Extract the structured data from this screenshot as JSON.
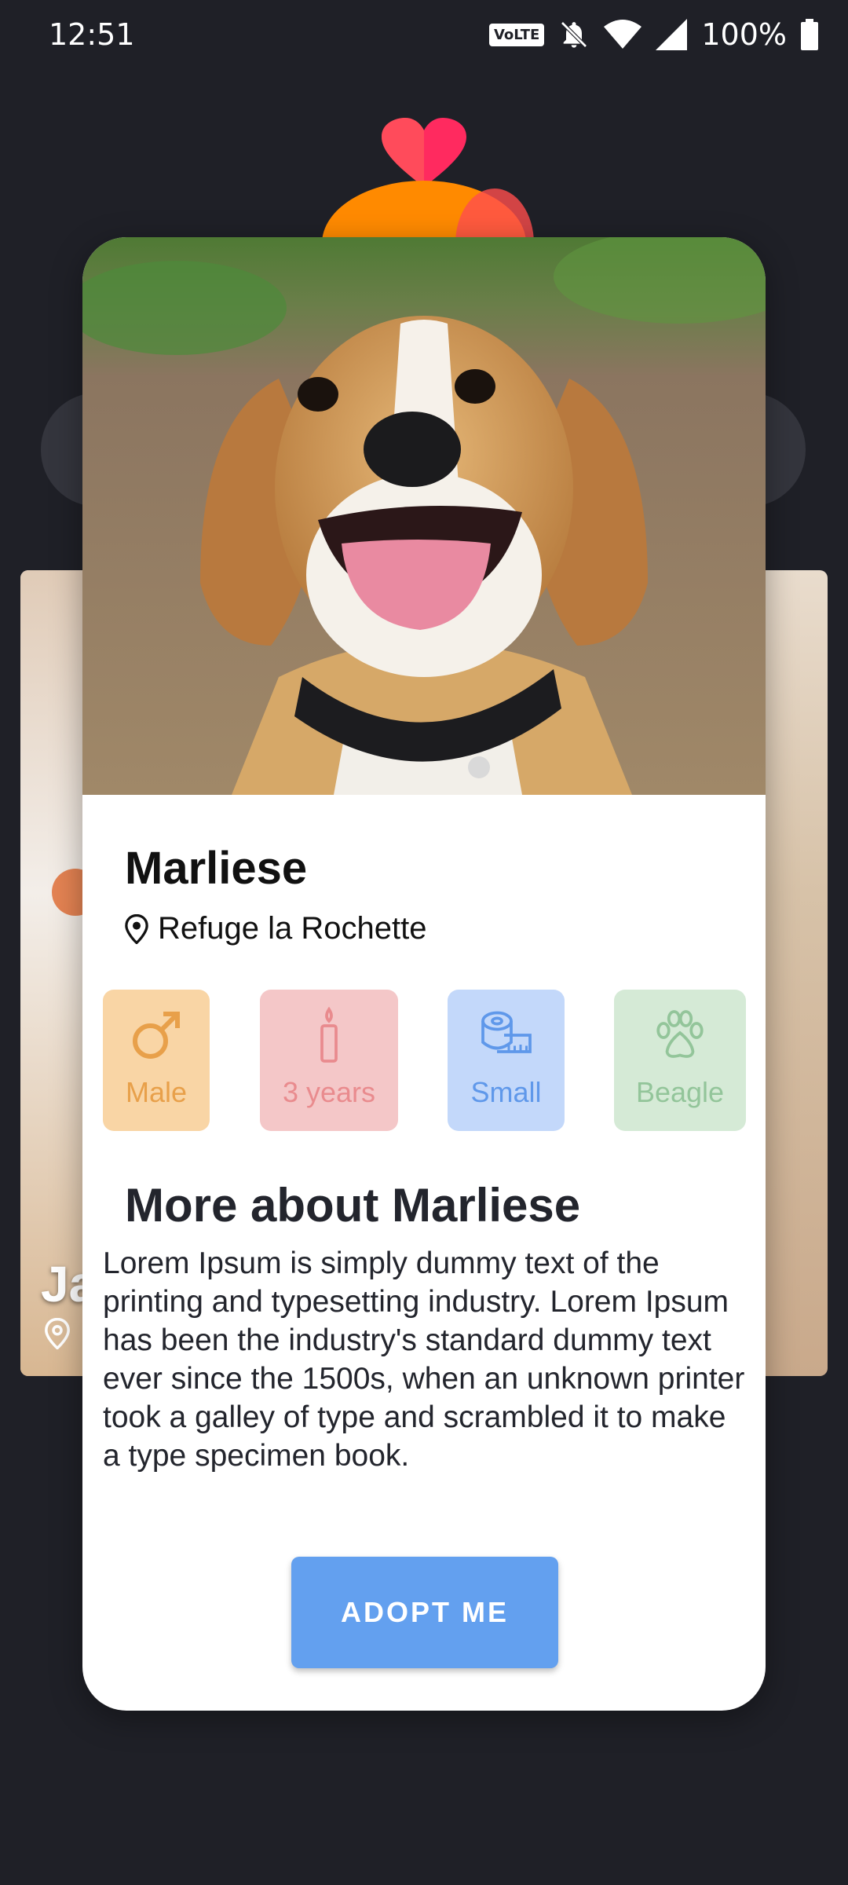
{
  "status_bar": {
    "time": "12:51",
    "volte": "VoLTE",
    "battery": "100%"
  },
  "background": {
    "card_name_fragment": "Ja"
  },
  "pet": {
    "name": "Marliese",
    "location": "Refuge la Rochette",
    "attributes": {
      "gender": "Male",
      "age": "3 years",
      "size": "Small",
      "breed": "Beagle"
    },
    "about_title": "More about Marliese",
    "about_text": "Lorem Ipsum is simply dummy text of the printing and typesetting industry. Lorem Ipsum has been the industry's standard dummy text ever since the 1500s, when an unknown printer took a galley of type and scrambled it to make a type specimen book.",
    "adopt_label": "ADOPT ME"
  },
  "colors": {
    "background": "#1f2027",
    "gender": "#e8a04a",
    "age": "#e98b8e",
    "size": "#5f98ea",
    "breed": "#93c59a",
    "button": "#63a0ef"
  },
  "icons": {
    "status": [
      "bell-off-icon",
      "wifi-icon",
      "signal-icon",
      "battery-icon"
    ],
    "location": "map-pin-icon",
    "gender": "male-symbol-icon",
    "age": "candle-icon",
    "size": "tape-measure-icon",
    "breed": "paw-icon"
  }
}
